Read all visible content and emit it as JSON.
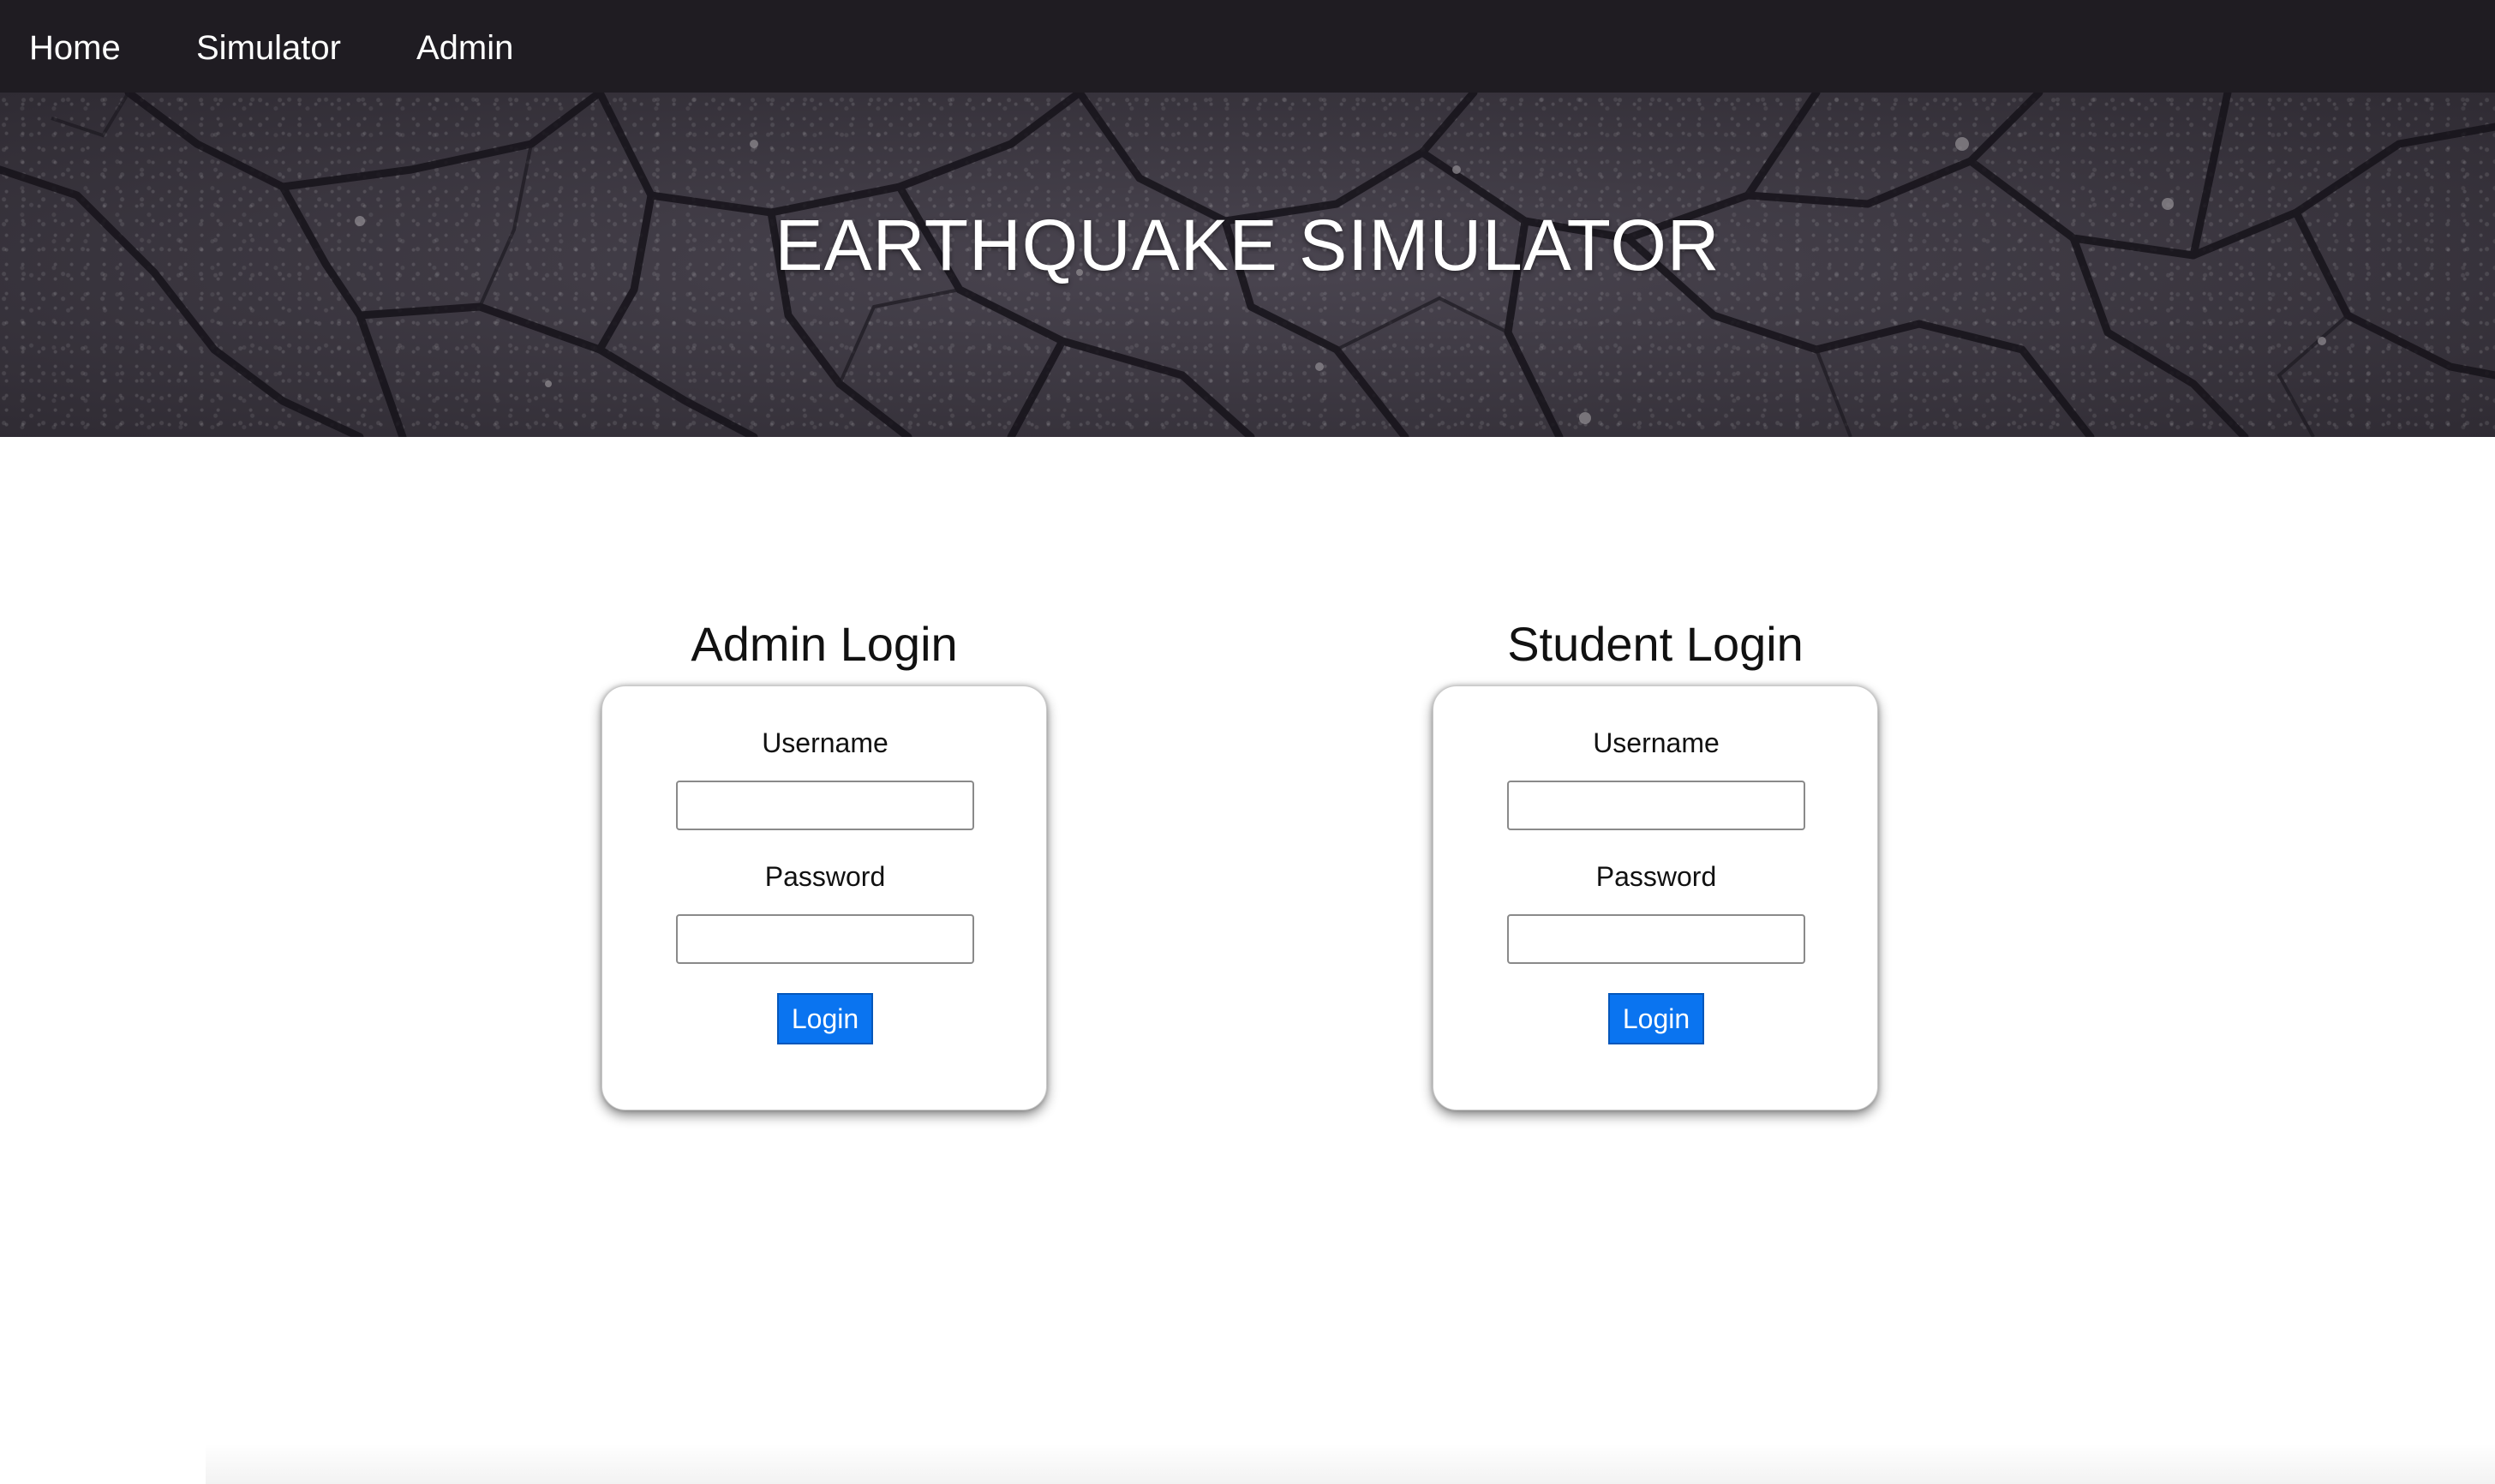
{
  "nav": {
    "home": "Home",
    "simulator": "Simulator",
    "admin": "Admin"
  },
  "hero": {
    "title": "EARTHQUAKE SIMULATOR"
  },
  "admin_login": {
    "heading": "Admin Login",
    "username_label": "Username",
    "username_value": "",
    "password_label": "Password",
    "password_value": "",
    "button_label": "Login"
  },
  "student_login": {
    "heading": "Student Login",
    "username_label": "Username",
    "username_value": "",
    "password_label": "Password",
    "password_value": "",
    "button_label": "Login"
  },
  "colors": {
    "navbar_bg": "#1f1c22",
    "button_bg": "#0a74f0"
  }
}
